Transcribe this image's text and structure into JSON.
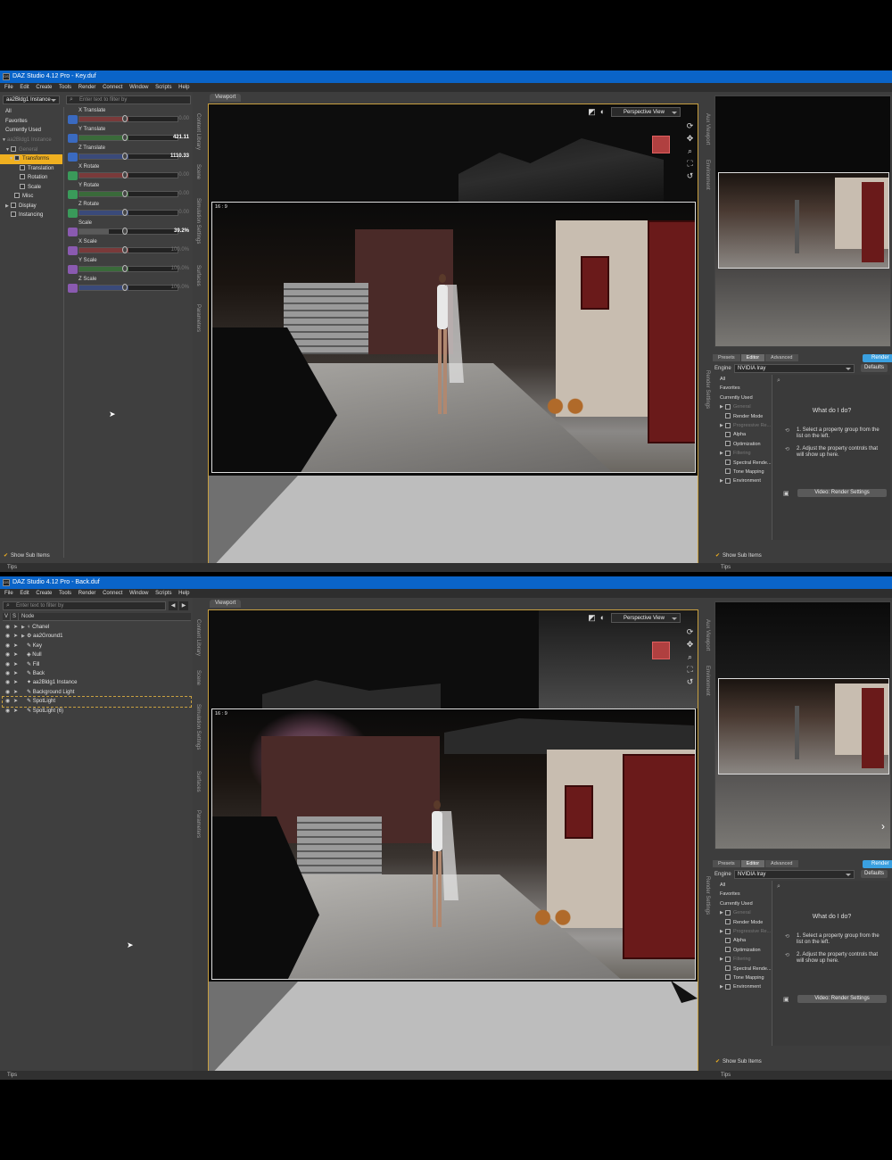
{
  "colors": {
    "titlebar": "#0a64c8",
    "accent": "#f0b020",
    "render": "#3aa0e0",
    "viewport_border": "#c8a040"
  },
  "menu": [
    "File",
    "Edit",
    "Create",
    "Tools",
    "Render",
    "Connect",
    "Window",
    "Scripts",
    "Help"
  ],
  "win1": {
    "title": "DAZ Studio 4.12 Pro - Key.duf",
    "node_select": "aa2Bldg1 Instance",
    "filter_placeholder": "Enter text to filter by",
    "categories": [
      "All",
      "Favorites",
      "Currently Used"
    ],
    "tree": [
      "aa2Bldg1 Instance",
      "General",
      "Transforms",
      "Translation",
      "Rotation",
      "Scale",
      "Misc",
      "Display",
      "Instancing"
    ],
    "params": [
      {
        "label": "X Translate",
        "value": "0.00"
      },
      {
        "label": "Y Translate",
        "value": "421.11"
      },
      {
        "label": "Z Translate",
        "value": "1110.33"
      },
      {
        "label": "X Rotate",
        "value": "0.00"
      },
      {
        "label": "Y Rotate",
        "value": "0.00"
      },
      {
        "label": "Z Rotate",
        "value": "0.00"
      },
      {
        "label": "Scale",
        "value": "39.2%"
      },
      {
        "label": "X Scale",
        "value": "100.0%"
      },
      {
        "label": "Y Scale",
        "value": "100.0%"
      },
      {
        "label": "Z Scale",
        "value": "100.0%"
      }
    ],
    "side_tabs": [
      "Content Library",
      "Scene",
      "Simulation Settings",
      "Surfaces",
      "Parameters"
    ],
    "show_sub": "Show Sub Items",
    "status": "Tips"
  },
  "win2": {
    "title": "DAZ Studio 4.12 Pro - Back.duf",
    "filter_placeholder": "Enter text to filter by",
    "node_header": {
      "v": "V",
      "s": "S",
      "node": "Node"
    },
    "nodes": [
      "Chanel",
      "aa2Ground1",
      "Key",
      "Null",
      "Fill",
      "Back",
      "aa2Bldg1 Instance",
      "Background Light",
      "SpotLight",
      "SpotLight (6)"
    ],
    "side_tabs": [
      "Content Library",
      "Scene",
      "Simulation Settings",
      "Surfaces",
      "Parameters"
    ],
    "status": "Tips"
  },
  "viewport": {
    "tab": "Viewport",
    "camera": "Perspective View",
    "ratio": "16 : 9"
  },
  "aux": {
    "tabs_label": [
      "Aux Viewport",
      "Environment"
    ]
  },
  "render_panel": {
    "tabs": [
      "Presets",
      "Editor",
      "Advanced"
    ],
    "render": "Render",
    "engine_label": "Engine",
    "engine": "NVIDIA Iray",
    "defaults": "Defaults",
    "cats": [
      "All",
      "Favorites",
      "Currently Used"
    ],
    "groups": [
      "General",
      "Render Mode",
      "Progressive Re...",
      "Alpha",
      "Optimization",
      "Filtering",
      "Spectral Rende...",
      "Tone Mapping",
      "Environment"
    ],
    "side_label": "Render Settings",
    "help_title": "What do I do?",
    "help1": "1. Select a property group from the list on the left.",
    "help2": "2. Adjust the property controls that will show up here.",
    "video": "Video: Render Settings",
    "show_sub": "Show Sub Items",
    "status": "Tips"
  }
}
